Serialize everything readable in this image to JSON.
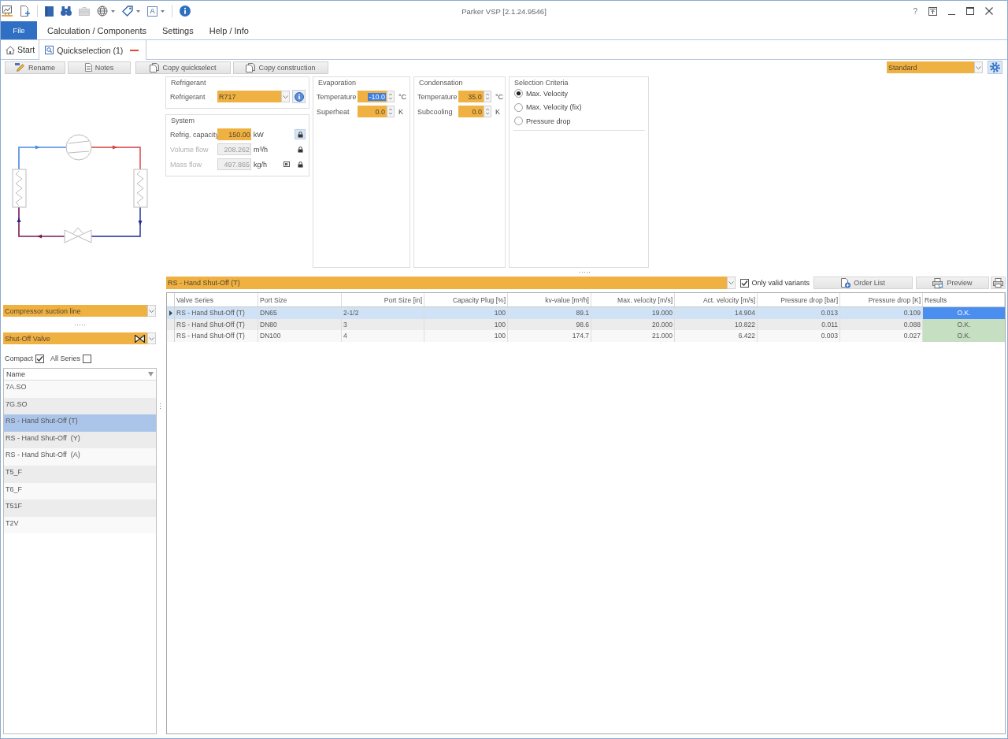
{
  "window": {
    "title": "Parker VSP [2.1.24.9546]",
    "help": "?"
  },
  "quick_access": {
    "text_button": "A"
  },
  "menu": [
    {
      "label": "File",
      "kind": "file"
    },
    {
      "label": "Calculation / Components",
      "kind": "menu"
    },
    {
      "label": "Settings",
      "kind": "menu"
    },
    {
      "label": "Help / Info",
      "kind": "menu"
    }
  ],
  "doc_tabs": [
    {
      "label": "Start",
      "kind": "home",
      "selected": false,
      "closable": false
    },
    {
      "label": "Quickselection (1)",
      "kind": "quickselection",
      "selected": true,
      "closable": true
    }
  ],
  "toolbar": {
    "buttons": [
      {
        "label": "Rename",
        "kind": "rename"
      },
      {
        "label": "Notes",
        "kind": "notes"
      },
      {
        "label": "Copy quickselect",
        "kind": "copy"
      },
      {
        "label": "Copy construction",
        "kind": "copy"
      }
    ],
    "profile": "Standard"
  },
  "diagram_panel": {
    "line": "Compressor suction line",
    "component": "Shut-Off Valve"
  },
  "filters": [
    {
      "label": "Compact",
      "checked": true
    },
    {
      "label": "All Series",
      "checked": false
    }
  ],
  "series_list": {
    "header": "Name",
    "items": [
      {
        "label": "7A.SO",
        "selected": false
      },
      {
        "label": "7G.SO",
        "selected": false
      },
      {
        "label": "RS - Hand Shut-Off (T)",
        "selected": true
      },
      {
        "label": "RS - Hand Shut-Off  (Y)",
        "selected": false
      },
      {
        "label": "RS - Hand Shut-Off  (A)",
        "selected": false
      },
      {
        "label": "T5_F",
        "selected": false
      },
      {
        "label": "T6_F",
        "selected": false
      },
      {
        "label": "T51F",
        "selected": false
      },
      {
        "label": "T2V",
        "selected": false
      }
    ]
  },
  "refrigerant": {
    "title": "Refrigerant",
    "label": "Refrigerant",
    "value": "R717"
  },
  "system": {
    "title": "System",
    "fields": [
      {
        "label": "Refrig. capacity",
        "value": "150.00",
        "unit": "kW",
        "disabled": false,
        "lock_active": true,
        "fix_toggle": false
      },
      {
        "label": "Volume flow",
        "value": "208.262",
        "unit": "m³/h",
        "disabled": true,
        "lock_active": false,
        "fix_toggle": false
      },
      {
        "label": "Mass flow",
        "value": "497.865",
        "unit": "kg/h",
        "disabled": true,
        "lock_active": false,
        "fix_toggle": true
      }
    ]
  },
  "evaporation": {
    "title": "Evaporation",
    "fields": [
      {
        "label": "Temperature",
        "value": "-10.0",
        "unit": "°C",
        "highlighted": true
      },
      {
        "label": "Superheat",
        "value": "0.0",
        "unit": "K",
        "highlighted": false
      }
    ]
  },
  "condensation": {
    "title": "Condensation",
    "fields": [
      {
        "label": "Temperature",
        "value": "35.0",
        "unit": "°C",
        "highlighted": false
      },
      {
        "label": "Subcooling",
        "value": "0.0",
        "unit": "K",
        "highlighted": false
      }
    ]
  },
  "selection_criteria": {
    "title": "Selection Criteria",
    "options": [
      {
        "label": "Max. Velocity",
        "selected": true
      },
      {
        "label": "Max. Velocity (fix)",
        "selected": false
      },
      {
        "label": "Pressure drop",
        "selected": false
      }
    ]
  },
  "series_bar": {
    "value": "RS - Hand Shut-Off (T)",
    "only_valid": {
      "label": "Only valid variants",
      "checked": true
    },
    "buttons": [
      {
        "label": "Order List",
        "kind": "order"
      },
      {
        "label": "Preview",
        "kind": "preview"
      },
      {
        "kind": "print"
      }
    ]
  },
  "table": {
    "columns": [
      "Valve Series",
      "Port Size",
      "Port Size [in]",
      "Capacity Plug [%]",
      "kv-value [m³/h]",
      "Max. velocity [m/s]",
      "Act. velocity [m/s]",
      "Pressure drop [bar]",
      "Pressure drop [K]",
      "Results"
    ],
    "rows": [
      {
        "cells": [
          "RS - Hand Shut-Off (T)",
          "DN65",
          "2-1/2",
          "100",
          "89.1",
          "19.000",
          "14.904",
          "0.013",
          "0.109"
        ],
        "result": "O.K.",
        "selected": true
      },
      {
        "cells": [
          "RS - Hand Shut-Off (T)",
          "DN80",
          "3",
          "100",
          "98.6",
          "20.000",
          "10.822",
          "0.011",
          "0.088"
        ],
        "result": "O.K.",
        "selected": false
      },
      {
        "cells": [
          "RS - Hand Shut-Off (T)",
          "DN100",
          "4",
          "100",
          "174.7",
          "21.000",
          "6.422",
          "0.003",
          "0.027"
        ],
        "result": "O.K.",
        "selected": false
      }
    ]
  }
}
